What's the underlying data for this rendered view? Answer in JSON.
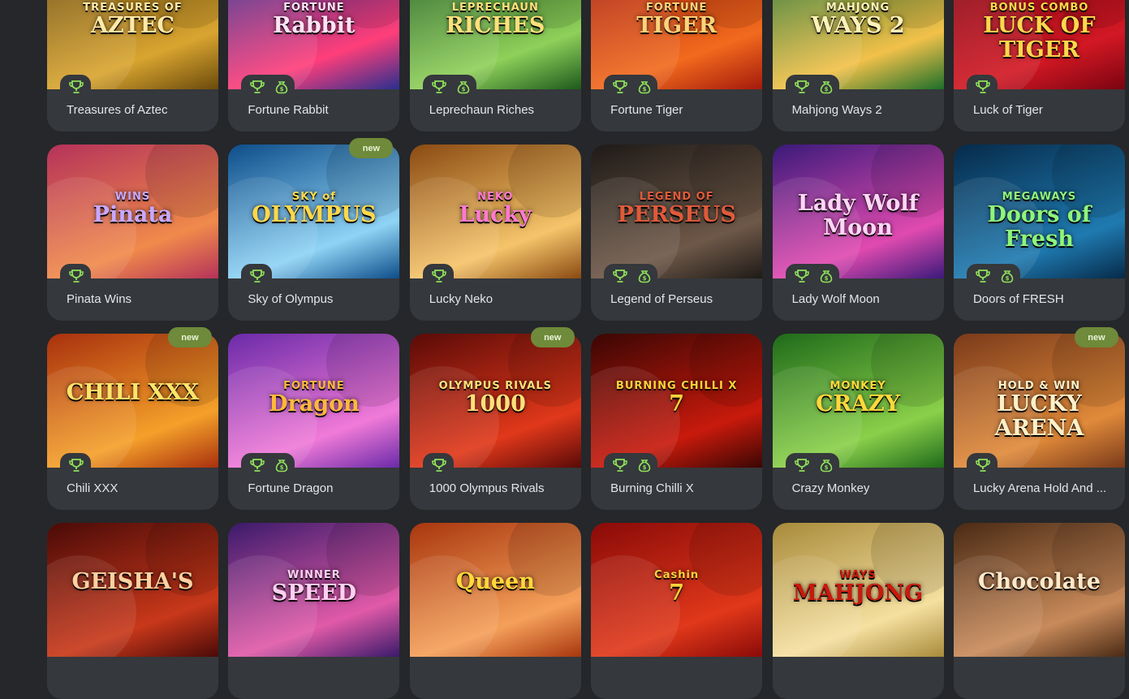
{
  "badge_text": "new",
  "games": [
    {
      "title": "Treasures of Aztec",
      "art": "AZTEC",
      "art_sub": "TREASURES OF",
      "bg": [
        "#6b4a0c",
        "#d9a530"
      ],
      "ink": "#ffe9a8",
      "trophy": true,
      "money": false,
      "badge": false
    },
    {
      "title": "Fortune Rabbit",
      "art": "Rabbit",
      "art_sub": "FORTUNE",
      "bg": [
        "#2a2f8f",
        "#ff3e7a"
      ],
      "ink": "#ffe3f5",
      "trophy": true,
      "money": true,
      "badge": false
    },
    {
      "title": "Leprechaun Riches",
      "art": "RICHES",
      "art_sub": "LEPRECHAUN",
      "bg": [
        "#1d5a1c",
        "#8fd05a"
      ],
      "ink": "#ffe07a",
      "trophy": true,
      "money": true,
      "badge": false
    },
    {
      "title": "Fortune Tiger",
      "art": "TIGER",
      "art_sub": "FORTUNE",
      "bg": [
        "#a31a0c",
        "#f26a1d"
      ],
      "ink": "#ffd37a",
      "trophy": true,
      "money": true,
      "badge": false
    },
    {
      "title": "Mahjong Ways 2",
      "art": "WAYS 2",
      "art_sub": "MAHJONG",
      "bg": [
        "#1d6f2a",
        "#f2c14a"
      ],
      "ink": "#fff2b8",
      "trophy": true,
      "money": true,
      "badge": false
    },
    {
      "title": "Luck of Tiger",
      "art": "LUCK OF TIGER",
      "art_sub": "BONUS COMBO",
      "bg": [
        "#7a0410",
        "#d21824"
      ],
      "ink": "#ffd84a",
      "trophy": true,
      "money": false,
      "badge": false
    },
    {
      "title": "Pinata Wins",
      "art": "Pinata",
      "art_sub": "WINS",
      "bg": [
        "#b5325a",
        "#f08a4b"
      ],
      "ink": "#c8a8ff",
      "trophy": true,
      "money": false,
      "badge": false
    },
    {
      "title": "Sky of Olympus",
      "art": "OLYMPUS",
      "art_sub": "SKY of",
      "bg": [
        "#0d4d8a",
        "#8fd3f5"
      ],
      "ink": "#ffd84a",
      "trophy": true,
      "money": false,
      "badge": true
    },
    {
      "title": "Lucky Neko",
      "art": "Lucky",
      "art_sub": "NEKO",
      "bg": [
        "#8a4a12",
        "#f5c46a"
      ],
      "ink": "#ff7ad0",
      "trophy": true,
      "money": false,
      "badge": false
    },
    {
      "title": "Legend of Perseus",
      "art": "PERSEUS",
      "art_sub": "LEGEND OF",
      "bg": [
        "#1e1a17",
        "#6e5848"
      ],
      "ink": "#e05a3a",
      "trophy": true,
      "money": true,
      "badge": false
    },
    {
      "title": "Lady Wolf Moon",
      "art": "Lady Wolf Moon",
      "art_sub": "",
      "bg": [
        "#3a1a7a",
        "#e04ab0"
      ],
      "ink": "#ffd6f5",
      "trophy": true,
      "money": true,
      "badge": false
    },
    {
      "title": "Doors of FRESH",
      "art": "Doors of Fresh",
      "art_sub": "MEGAWAYS",
      "bg": [
        "#062a4a",
        "#1f7ab0"
      ],
      "ink": "#8ff57a",
      "trophy": true,
      "money": true,
      "badge": false
    },
    {
      "title": "Chili XXX",
      "art": "CHILI XXX",
      "art_sub": "",
      "bg": [
        "#a8300e",
        "#f5a02a"
      ],
      "ink": "#ffe36a",
      "trophy": true,
      "money": false,
      "badge": true
    },
    {
      "title": "Fortune Dragon",
      "art": "Dragon",
      "art_sub": "FORTUNE",
      "bg": [
        "#6a2aa8",
        "#f07ad8"
      ],
      "ink": "#ffb83a",
      "trophy": true,
      "money": true,
      "badge": false
    },
    {
      "title": "1000 Olympus Rivals",
      "art": "1000",
      "art_sub": "OLYMPUS RIVALS",
      "bg": [
        "#5a0a08",
        "#e0381a"
      ],
      "ink": "#ffe07a",
      "trophy": true,
      "money": false,
      "badge": true
    },
    {
      "title": "Burning Chilli X",
      "art": "7",
      "art_sub": "BURNING CHILLI X",
      "bg": [
        "#3a0604",
        "#c81a0c"
      ],
      "ink": "#ffd23a",
      "trophy": true,
      "money": true,
      "badge": false
    },
    {
      "title": "Crazy Monkey",
      "art": "CRAZY",
      "art_sub": "MONKEY",
      "bg": [
        "#1f6a1a",
        "#8ad04a"
      ],
      "ink": "#ffd83a",
      "trophy": true,
      "money": true,
      "badge": false
    },
    {
      "title": "Lucky Arena Hold And ...",
      "art": "LUCKY ARENA",
      "art_sub": "HOLD & WIN",
      "bg": [
        "#7a3a1a",
        "#e08a3a"
      ],
      "ink": "#fff0c8",
      "trophy": true,
      "money": false,
      "badge": true
    },
    {
      "title": "",
      "art": "GEISHA'S",
      "art_sub": "",
      "bg": [
        "#4a0a08",
        "#c8381a"
      ],
      "ink": "#ffd0a0",
      "trophy": false,
      "money": false,
      "badge": false
    },
    {
      "title": "",
      "art": "SPEED",
      "art_sub": "WINNER",
      "bg": [
        "#3a1a6a",
        "#e05aa8"
      ],
      "ink": "#ffd0f0",
      "trophy": false,
      "money": false,
      "badge": false
    },
    {
      "title": "",
      "art": "Queen",
      "art_sub": "",
      "bg": [
        "#a8360e",
        "#f5a05a"
      ],
      "ink": "#ffd83a",
      "trophy": false,
      "money": false,
      "badge": false
    },
    {
      "title": "",
      "art": "7",
      "art_sub": "Cashin",
      "bg": [
        "#8a0a08",
        "#e0381a"
      ],
      "ink": "#ffd23a",
      "trophy": false,
      "money": false,
      "badge": false
    },
    {
      "title": "",
      "art": "MAHJONG",
      "art_sub": "WAYS",
      "bg": [
        "#a88a3a",
        "#f5e0a0"
      ],
      "ink": "#c81a0c",
      "trophy": false,
      "money": false,
      "badge": false
    },
    {
      "title": "",
      "art": "Chocolate",
      "art_sub": "",
      "bg": [
        "#4a2a14",
        "#c88a5a"
      ],
      "ink": "#ffe8c8",
      "trophy": false,
      "money": false,
      "badge": false
    }
  ]
}
